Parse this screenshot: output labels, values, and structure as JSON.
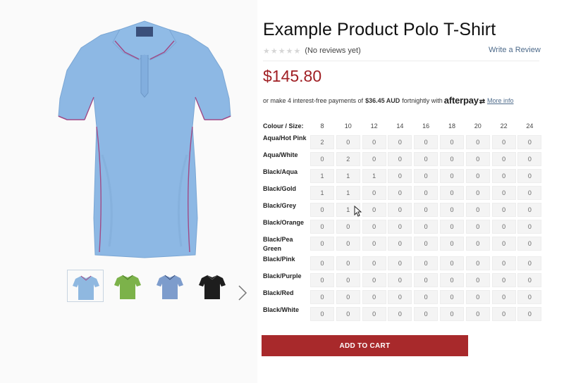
{
  "product": {
    "title": "Example Product Polo T-Shirt",
    "stars": "★★★★★",
    "reviews_text": "(No reviews yet)",
    "write_review": "Write a Review",
    "price": "$145.80"
  },
  "afterpay": {
    "prefix": "or make 4 interest-free payments of",
    "amount": "$36.45 AUD",
    "suffix": "fortnightly with",
    "logo": "afterpay",
    "more_info": "More info"
  },
  "grid": {
    "corner_label": "Colour / Size:",
    "sizes": [
      "8",
      "10",
      "12",
      "14",
      "16",
      "18",
      "20",
      "22",
      "24"
    ],
    "rows": [
      {
        "colour": "Aqua/Hot Pink",
        "qty": [
          "2",
          "0",
          "0",
          "0",
          "0",
          "0",
          "0",
          "0",
          "0"
        ]
      },
      {
        "colour": "Aqua/White",
        "qty": [
          "0",
          "2",
          "0",
          "0",
          "0",
          "0",
          "0",
          "0",
          "0"
        ]
      },
      {
        "colour": "Black/Aqua",
        "qty": [
          "1",
          "1",
          "1",
          "0",
          "0",
          "0",
          "0",
          "0",
          "0"
        ]
      },
      {
        "colour": "Black/Gold",
        "qty": [
          "1",
          "1",
          "0",
          "0",
          "0",
          "0",
          "0",
          "0",
          "0"
        ]
      },
      {
        "colour": "Black/Grey",
        "qty": [
          "0",
          "1",
          "0",
          "0",
          "0",
          "0",
          "0",
          "0",
          "0"
        ]
      },
      {
        "colour": "Black/Orange",
        "qty": [
          "0",
          "0",
          "0",
          "0",
          "0",
          "0",
          "0",
          "0",
          "0"
        ]
      },
      {
        "colour": "Black/Pea Green",
        "qty": [
          "0",
          "0",
          "0",
          "0",
          "0",
          "0",
          "0",
          "0",
          "0"
        ]
      },
      {
        "colour": "Black/Pink",
        "qty": [
          "0",
          "0",
          "0",
          "0",
          "0",
          "0",
          "0",
          "0",
          "0"
        ]
      },
      {
        "colour": "Black/Purple",
        "qty": [
          "0",
          "0",
          "0",
          "0",
          "0",
          "0",
          "0",
          "0",
          "0"
        ]
      },
      {
        "colour": "Black/Red",
        "qty": [
          "0",
          "0",
          "0",
          "0",
          "0",
          "0",
          "0",
          "0",
          "0"
        ]
      },
      {
        "colour": "Black/White",
        "qty": [
          "0",
          "0",
          "0",
          "0",
          "0",
          "0",
          "0",
          "0",
          "0"
        ]
      }
    ]
  },
  "cart": {
    "label": "ADD TO CART"
  },
  "thumbnails": [
    {
      "name": "aqua-hot-pink",
      "color": "#8fb8e0"
    },
    {
      "name": "green",
      "color": "#7cb24a"
    },
    {
      "name": "blue-grey",
      "color": "#7d9ccc"
    },
    {
      "name": "black",
      "color": "#1d1d1d"
    }
  ],
  "colors": {
    "price": "#a01f24",
    "cart_button": "#a8292b",
    "link": "#4d6a8a",
    "shirt": "#8db8e4",
    "trim": "#a04a86"
  },
  "icons": {
    "next": "chevron-right-icon",
    "cursor": "mouse-pointer-icon",
    "stars": "star-icon"
  }
}
